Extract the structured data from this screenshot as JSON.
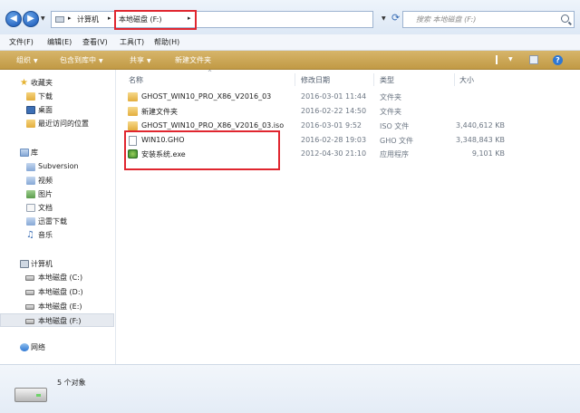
{
  "address": {
    "segments": [
      "计算机",
      "本地磁盘 (F:)"
    ],
    "search_placeholder": "搜索 本地磁盘 (F:)"
  },
  "menu": [
    "文件(F)",
    "编辑(E)",
    "查看(V)",
    "工具(T)",
    "帮助(H)"
  ],
  "toolbar": {
    "organize": "组织",
    "include_library": "包含到库中",
    "share": "共享",
    "new_folder": "新建文件夹"
  },
  "nav": {
    "favorites": "收藏夹",
    "downloads": "下载",
    "desktop": "桌面",
    "recent": "最近访问的位置",
    "libraries": "库",
    "subversion": "Subversion",
    "videos": "视频",
    "pictures": "图片",
    "documents": "文档",
    "thunder": "迅雷下载",
    "music": "音乐",
    "computer": "计算机",
    "drive_c": "本地磁盘 (C:)",
    "drive_d": "本地磁盘 (D:)",
    "drive_e": "本地磁盘 (E:)",
    "drive_f": "本地磁盘 (F:)",
    "network": "网络"
  },
  "columns": {
    "name": "名称",
    "date": "修改日期",
    "type": "类型",
    "size": "大小"
  },
  "files": [
    {
      "name": "GHOST_WIN10_PRO_X86_V2016_03",
      "date": "2016-03-01 11:44",
      "type": "文件夹",
      "size": "",
      "icon": "folder-icon"
    },
    {
      "name": "新建文件夹",
      "date": "2016-02-22 14:50",
      "type": "文件夹",
      "size": "",
      "icon": "folder-icon"
    },
    {
      "name": "GHOST_WIN10_PRO_X86_V2016_03.iso",
      "date": "2016-03-01 9:52",
      "type": "ISO 文件",
      "size": "3,440,612 KB",
      "icon": "iso-file-icon"
    },
    {
      "name": "WIN10.GHO",
      "date": "2016-02-28 19:03",
      "type": "GHO 文件",
      "size": "3,348,843 KB",
      "icon": "gho-file-icon"
    },
    {
      "name": "安装系统.exe",
      "date": "2012-04-30 21:10",
      "type": "应用程序",
      "size": "9,101 KB",
      "icon": "exe-app-icon"
    }
  ],
  "status": {
    "object_count": "5 个对象"
  }
}
